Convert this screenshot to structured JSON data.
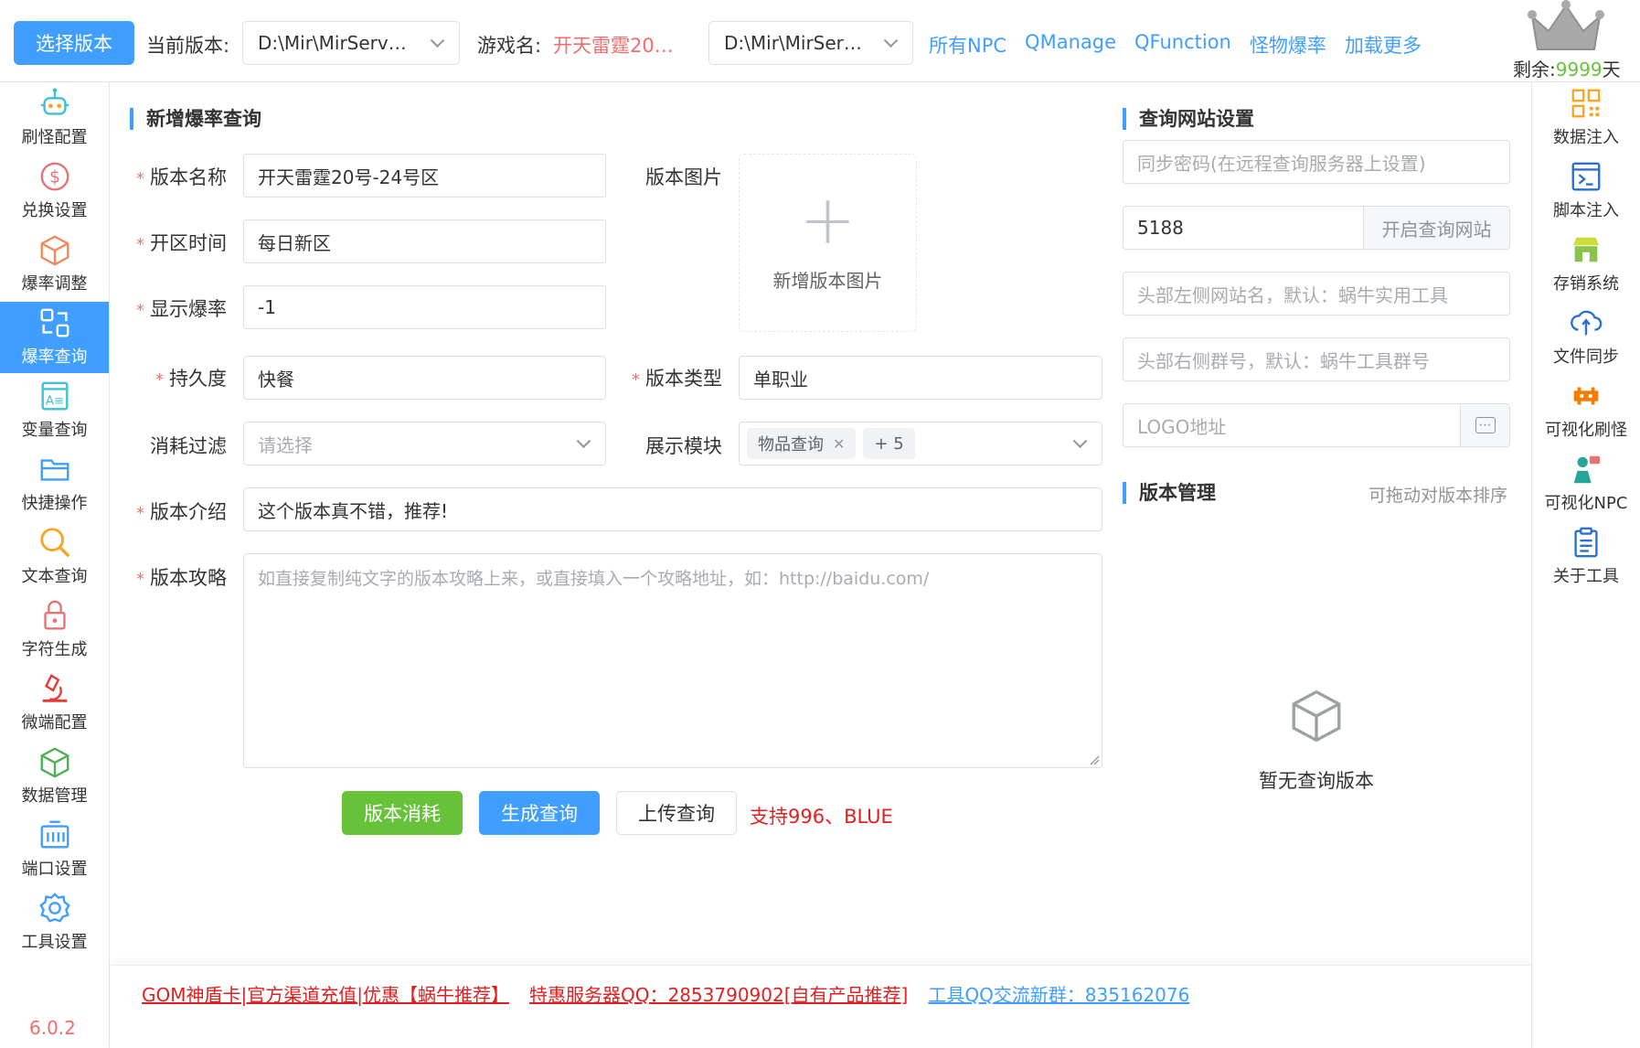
{
  "topbar": {
    "select_version_label": "选择版本",
    "current_version_label": "当前版本:",
    "current_version_value": "D:\\Mir\\MirServer...",
    "game_name_label": "游戏名:",
    "game_name_value": "开天雷霆20号...",
    "second_path_value": "D:\\Mir\\MirServ...",
    "links": [
      "所有NPC",
      "QManage",
      "QFunction",
      "怪物爆率",
      "加载更多"
    ],
    "remain_label": "剩余:",
    "remain_value": "9999",
    "remain_unit": "天"
  },
  "leftbar": {
    "items": [
      {
        "label": "刷怪配置",
        "icon": "robot-icon"
      },
      {
        "label": "兑换设置",
        "icon": "dollar-icon"
      },
      {
        "label": "爆率调整",
        "icon": "cube-icon"
      },
      {
        "label": "爆率查询",
        "icon": "query-icon"
      },
      {
        "label": "变量查询",
        "icon": "variable-icon"
      },
      {
        "label": "快捷操作",
        "icon": "folder-icon"
      },
      {
        "label": "文本查询",
        "icon": "magnifier-icon"
      },
      {
        "label": "字符生成",
        "icon": "lock-icon"
      },
      {
        "label": "微端配置",
        "icon": "microscope-icon"
      },
      {
        "label": "数据管理",
        "icon": "box-icon"
      },
      {
        "label": "端口设置",
        "icon": "port-icon"
      },
      {
        "label": "工具设置",
        "icon": "gear-icon"
      }
    ],
    "version": "6.0.2"
  },
  "rightbar": {
    "items": [
      {
        "label": "数据注入",
        "icon": "qrcode-icon"
      },
      {
        "label": "脚本注入",
        "icon": "terminal-icon"
      },
      {
        "label": "存销系统",
        "icon": "store-icon"
      },
      {
        "label": "文件同步",
        "icon": "cloud-sync-icon"
      },
      {
        "label": "可视化刷怪",
        "icon": "invader-icon"
      },
      {
        "label": "可视化NPC",
        "icon": "npc-icon"
      },
      {
        "label": "关于工具",
        "icon": "clipboard-icon"
      }
    ]
  },
  "form": {
    "title": "新增爆率查询",
    "version_name_label": "版本名称",
    "version_name_value": "开天雷霆20号-24号区",
    "open_time_label": "开区时间",
    "open_time_value": "每日新区",
    "show_rate_label": "显示爆率",
    "show_rate_value": "-1",
    "durability_label": "持久度",
    "durability_value": "快餐",
    "version_type_label": "版本类型",
    "version_type_value": "单职业",
    "consume_filter_label": "消耗过滤",
    "consume_filter_placeholder": "请选择",
    "display_module_label": "展示模块",
    "display_module_tag": "物品查询",
    "display_module_more": "+ 5",
    "version_image_label": "版本图片",
    "upload_text": "新增版本图片",
    "intro_label": "版本介绍",
    "intro_value": "这个版本真不错，推荐!",
    "guide_label": "版本攻略",
    "guide_placeholder": "如直接复制纯文字的版本攻略上来，或直接填入一个攻略地址，如：http://baidu.com/",
    "btn_consume": "版本消耗",
    "btn_generate": "生成查询",
    "btn_upload": "上传查询",
    "support_text": "支持996、BLUE"
  },
  "site_settings": {
    "title": "查询网站设置",
    "sync_password_placeholder": "同步密码(在远程查询服务器上设置)",
    "port_value": "5188",
    "open_site_button": "开启查询网站",
    "left_name_placeholder": "头部左侧网站名，默认：蜗牛实用工具",
    "right_group_placeholder": "头部右侧群号，默认：蜗牛工具群号",
    "logo_placeholder": "LOGO地址",
    "logo_button": "⋯"
  },
  "version_manage": {
    "title": "版本管理",
    "sort_hint": "可拖动对版本排序",
    "empty_text": "暂无查询版本"
  },
  "footer": {
    "link1": "GOM神盾卡|官方渠道充值|优惠【蜗牛推荐】",
    "link2": "特惠服务器QQ：2853790902[自有产品推荐]",
    "link3": "工具QQ交流新群：835162076"
  }
}
